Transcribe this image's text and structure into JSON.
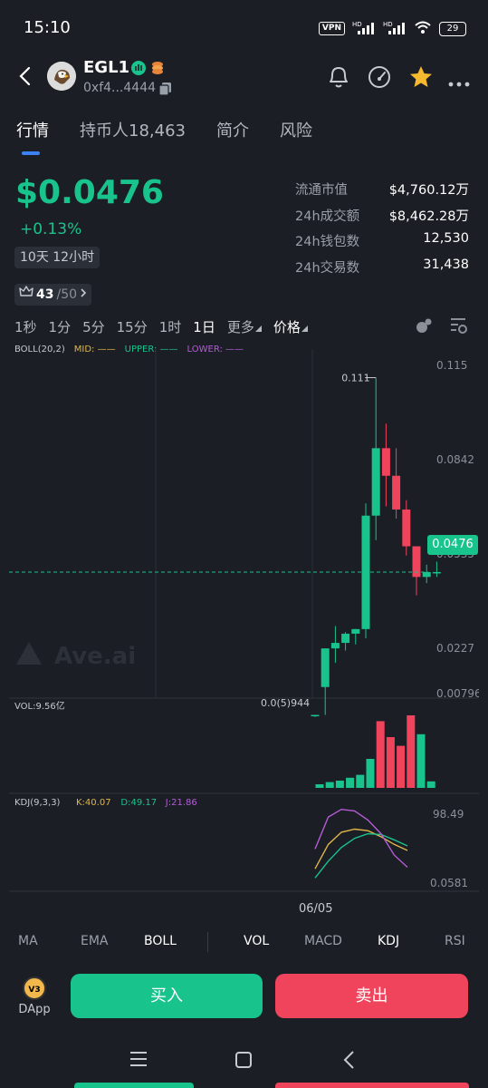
{
  "status_bar": {
    "time": "15:10",
    "vpn": "VPN",
    "hd1": "HD",
    "hd2": "HD",
    "battery": "29"
  },
  "header": {
    "token_name": "EGL1",
    "address": "0xf4...4444"
  },
  "tabs": [
    "行情",
    "持币人18,463",
    "简介",
    "风险"
  ],
  "price": {
    "value": "$0.0476",
    "change": "+0.13%",
    "age": "10天 12小时",
    "score": "43",
    "score_total": "/50"
  },
  "stats": [
    {
      "label": "流通市值",
      "value": "$4,760.12万"
    },
    {
      "label": "24h成交额",
      "value": "$8,462.28万"
    },
    {
      "label": "24h钱包数",
      "value": "12,530"
    },
    {
      "label": "24h交易数",
      "value": "31,438"
    }
  ],
  "timeframes": [
    "1秒",
    "1分",
    "5分",
    "15分",
    "1时",
    "1日",
    "更多",
    "价格"
  ],
  "boll": {
    "label": "BOLL(20,2)",
    "mid": "MID:",
    "upper": "UPPER:",
    "lower": "LOWER:"
  },
  "colors": {
    "up": "#19c38c",
    "down": "#f0435c",
    "mid": "#e0b64a",
    "upper": "#19c38c",
    "lower": "#b45cd6",
    "bg": "#1b1e25"
  },
  "watermark": "Ave.ai",
  "chart_data": [
    {
      "type": "candlestick",
      "y_ticks": [
        "0.115",
        "0.0842",
        "0.0535",
        "0.0227",
        "0.00796"
      ],
      "max_label": "0.111",
      "min_label": "0.0(5)944",
      "current_price": "0.0476",
      "candles": [
        {
          "o": 0.001,
          "h": 0.001,
          "l": 0.0003,
          "c": 0.001
        },
        {
          "o": 0.0101,
          "h": 0.0227,
          "l": 0.001,
          "c": 0.0227
        },
        {
          "o": 0.0227,
          "h": 0.03,
          "l": 0.018,
          "c": 0.0245
        },
        {
          "o": 0.0245,
          "h": 0.028,
          "l": 0.022,
          "c": 0.0275
        },
        {
          "o": 0.0275,
          "h": 0.029,
          "l": 0.024,
          "c": 0.029
        },
        {
          "o": 0.029,
          "h": 0.07,
          "l": 0.026,
          "c": 0.066
        },
        {
          "o": 0.066,
          "h": 0.111,
          "l": 0.058,
          "c": 0.088
        },
        {
          "o": 0.088,
          "h": 0.096,
          "l": 0.069,
          "c": 0.079
        },
        {
          "o": 0.079,
          "h": 0.088,
          "l": 0.065,
          "c": 0.068
        },
        {
          "o": 0.068,
          "h": 0.071,
          "l": 0.053,
          "c": 0.056
        },
        {
          "o": 0.056,
          "h": 0.056,
          "l": 0.04,
          "c": 0.046
        },
        {
          "o": 0.046,
          "h": 0.05,
          "l": 0.044,
          "c": 0.0476
        },
        {
          "o": 0.0476,
          "h": 0.051,
          "l": 0.046,
          "c": 0.0476
        }
      ]
    },
    {
      "type": "bar",
      "label": "VOL:9.56亿",
      "values": [
        0.05,
        0.08,
        0.1,
        0.14,
        0.18,
        0.4,
        0.92,
        0.7,
        0.58,
        1.0,
        0.74,
        0.09
      ],
      "up": [
        true,
        true,
        true,
        true,
        true,
        true,
        false,
        false,
        false,
        false,
        true,
        true
      ]
    },
    {
      "type": "line",
      "title": "KDJ(9,3,3)",
      "k_label": "K:40.07",
      "d_label": "D:49.17",
      "j_label": "J:21.86",
      "y_ticks": [
        "98.49",
        "0.0581"
      ],
      "x_label": "06/05",
      "series": [
        {
          "name": "K",
          "values": [
            20,
            52,
            68,
            72,
            70,
            62,
            52,
            44
          ]
        },
        {
          "name": "D",
          "values": [
            8,
            30,
            48,
            60,
            66,
            65,
            58,
            50
          ]
        },
        {
          "name": "J",
          "values": [
            46,
            88,
            98,
            96,
            84,
            66,
            38,
            22
          ]
        }
      ]
    }
  ],
  "indicator_bar": [
    "MA",
    "EMA",
    "BOLL",
    "VOL",
    "MACD",
    "KDJ",
    "RSI"
  ],
  "actions": {
    "dapp": "DApp",
    "v3": "V3",
    "buy": "买入",
    "sell": "卖出"
  }
}
